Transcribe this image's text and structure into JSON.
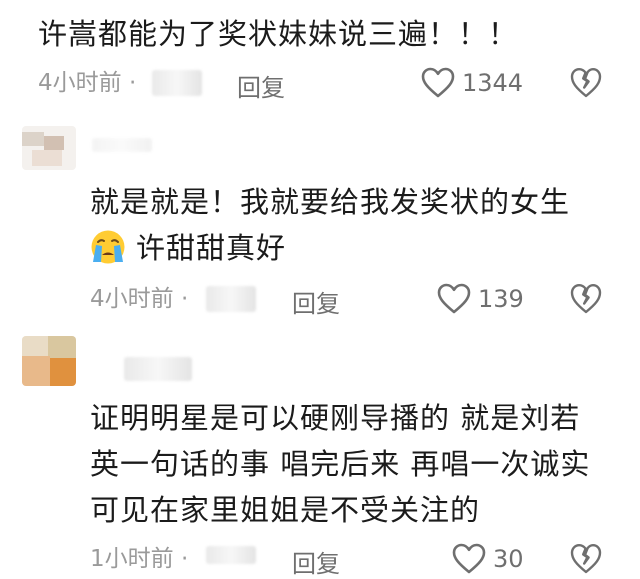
{
  "comments": [
    {
      "lines": [
        "许嵩都能为了奖状妹妹说三遍！！！"
      ],
      "time": "4小时前 ·",
      "reply_label": "回复",
      "like_count": "1344"
    },
    {
      "lines": [
        "就是就是！我就要给我发奖状的女生",
        "许甜甜真好"
      ],
      "time": "4小时前 ·",
      "reply_label": "回复",
      "like_count": "139"
    },
    {
      "lines": [
        "证明明星是可以硬刚导播的 就是刘若",
        "英一句话的事 唱完后来 再唱一次诚实",
        "可见在家里姐姐是不受关注的"
      ],
      "time": "1小时前 ·",
      "reply_label": "回复",
      "like_count": "30"
    }
  ],
  "icons": {
    "like": "heart-outline-icon",
    "dislike": "broken-heart-icon",
    "emoji": "crying-face-emoji"
  },
  "colors": {
    "text": "#1b1b1b",
    "meta": "#9a9a9a",
    "icon": "#6f6f6f"
  }
}
